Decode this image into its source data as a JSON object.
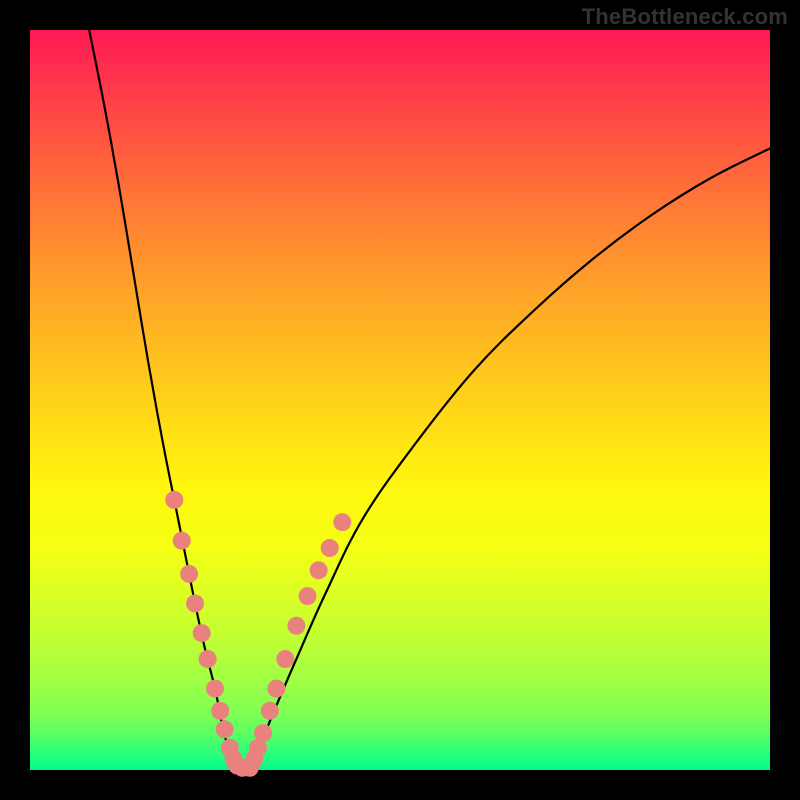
{
  "watermark": "TheBottleneck.com",
  "chart_data": {
    "type": "line",
    "title": "",
    "xlabel": "",
    "ylabel": "",
    "xlim": [
      0,
      100
    ],
    "ylim": [
      0,
      100
    ],
    "grid": false,
    "legend": false,
    "series": [
      {
        "name": "curve-left",
        "x": [
          8,
          10,
          12,
          14,
          16,
          18,
          20,
          22,
          23.5,
          25,
          26,
          27,
          27.5
        ],
        "y": [
          100,
          90,
          79,
          67,
          55,
          44,
          34,
          24,
          17,
          11,
          6,
          2,
          0
        ]
      },
      {
        "name": "curve-right",
        "x": [
          30,
          31,
          33,
          36,
          40,
          45,
          52,
          60,
          68,
          76,
          84,
          92,
          100
        ],
        "y": [
          0,
          3,
          8,
          15,
          24,
          34,
          44,
          54,
          62,
          69,
          75,
          80,
          84
        ]
      }
    ],
    "scatter": [
      {
        "name": "dots-left",
        "color": "#e9827e",
        "points": [
          {
            "x": 19.5,
            "y": 36.5
          },
          {
            "x": 20.5,
            "y": 31
          },
          {
            "x": 21.5,
            "y": 26.5
          },
          {
            "x": 22.3,
            "y": 22.5
          },
          {
            "x": 23.2,
            "y": 18.5
          },
          {
            "x": 24.0,
            "y": 15
          },
          {
            "x": 25.0,
            "y": 11
          },
          {
            "x": 25.7,
            "y": 8
          },
          {
            "x": 26.3,
            "y": 5.5
          },
          {
            "x": 27.0,
            "y": 3
          },
          {
            "x": 27.5,
            "y": 1.5
          },
          {
            "x": 28.0,
            "y": 0.6
          },
          {
            "x": 28.7,
            "y": 0.3
          }
        ]
      },
      {
        "name": "dots-right",
        "color": "#e9827e",
        "points": [
          {
            "x": 29.7,
            "y": 0.3
          },
          {
            "x": 30.3,
            "y": 1.5
          },
          {
            "x": 30.8,
            "y": 3
          },
          {
            "x": 31.5,
            "y": 5
          },
          {
            "x": 32.4,
            "y": 8
          },
          {
            "x": 33.3,
            "y": 11
          },
          {
            "x": 34.5,
            "y": 15
          },
          {
            "x": 36.0,
            "y": 19.5
          },
          {
            "x": 37.5,
            "y": 23.5
          },
          {
            "x": 39.0,
            "y": 27
          },
          {
            "x": 40.5,
            "y": 30
          },
          {
            "x": 42.2,
            "y": 33.5
          }
        ]
      }
    ]
  }
}
